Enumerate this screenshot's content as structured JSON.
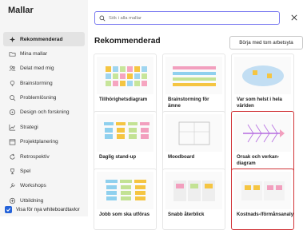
{
  "sidebar": {
    "title": "Mallar",
    "items": [
      {
        "label": "Rekommenderad",
        "icon": "sparkle-icon",
        "active": true
      },
      {
        "label": "Mina mallar",
        "icon": "folder-icon"
      },
      {
        "label": "Delat med mig",
        "icon": "people-icon"
      },
      {
        "label": "Brainstorming",
        "icon": "lightbulb-icon"
      },
      {
        "label": "Problemlösning",
        "icon": "magnifier-icon"
      },
      {
        "label": "Design och forskning",
        "icon": "design-icon"
      },
      {
        "label": "Strategi",
        "icon": "chart-icon"
      },
      {
        "label": "Projektplanering",
        "icon": "calendar-icon"
      },
      {
        "label": "Retrospektiv",
        "icon": "refresh-icon"
      },
      {
        "label": "Spel",
        "icon": "trophy-icon"
      },
      {
        "label": "Workshops",
        "icon": "wrench-icon"
      },
      {
        "label": "Utbildning",
        "icon": "book-icon"
      }
    ],
    "footer_checkbox_label": "Visa för nya whiteboardtavlor",
    "footer_checked": true
  },
  "search": {
    "placeholder": "Sök i alla mallar"
  },
  "main": {
    "section_title": "Rekommenderad",
    "blank_button_label": "Börja med tom arbetsyta",
    "templates": [
      {
        "label": "Tillhörighetsdiagram",
        "thumb": "sticky-grid",
        "colors": [
          "#f5c542",
          "#9fd5f0",
          "#c7e59a",
          "#f6a5c0"
        ]
      },
      {
        "label": "Brainstorming för ämne",
        "thumb": "bar-rows",
        "colors": [
          "#f29fbe",
          "#8fd0ee",
          "#c3e294",
          "#f5c542"
        ]
      },
      {
        "label": "Var som helst i hela världen",
        "thumb": "map",
        "colors": [
          "#5aa9e6",
          "#f5c542"
        ]
      },
      {
        "label": "Daglig stand-up",
        "thumb": "columns",
        "colors": [
          "#8fd0ee",
          "#f5c542",
          "#c3e294",
          "#f29fbe"
        ]
      },
      {
        "label": "Moodboard",
        "thumb": "frames",
        "colors": [
          "#c8c8c8"
        ]
      },
      {
        "label": "Orsak och verkan-diagram",
        "thumb": "fishbone",
        "colors": [
          "#b46ae0",
          "#f29fbe"
        ],
        "highlight": true
      },
      {
        "label": "Jobb som ska utföras",
        "thumb": "grid-cards",
        "colors": [
          "#8fd0ee",
          "#c3e294",
          "#f5c542"
        ]
      },
      {
        "label": "Snabb återblick",
        "thumb": "retro",
        "colors": [
          "#f29fbe",
          "#c3e294",
          "#f5c542"
        ]
      },
      {
        "label": "Kostnads-/förmånsanalys",
        "thumb": "cost",
        "colors": [
          "#f5c542",
          "#8fd0ee",
          "#f29fbe"
        ],
        "highlight": true
      }
    ]
  }
}
